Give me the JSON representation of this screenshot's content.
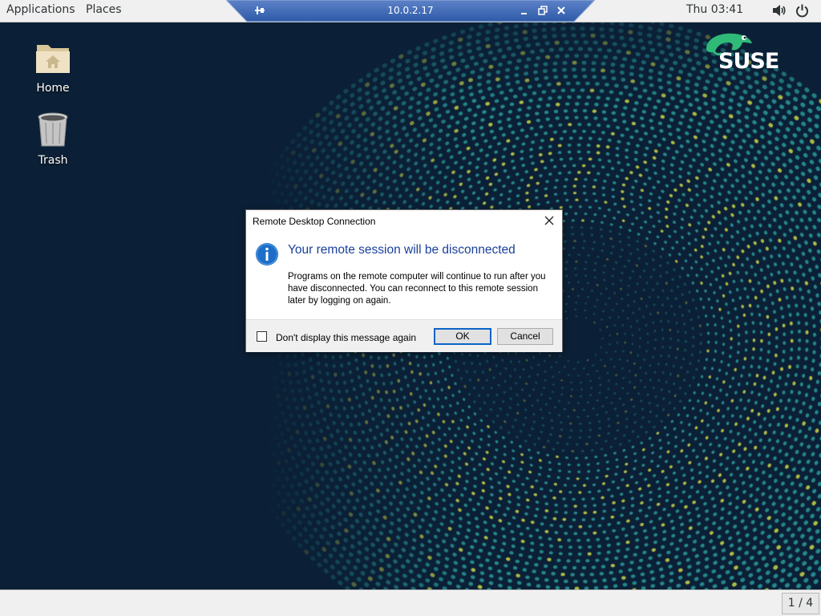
{
  "top_panel": {
    "applications_label": "Applications",
    "places_label": "Places",
    "clock": "Thu 03:41"
  },
  "rdp_bar": {
    "title": "10.0.2.17"
  },
  "desktop": {
    "icons": [
      {
        "label": "Home",
        "icon": "home-folder-icon"
      },
      {
        "label": "Trash",
        "icon": "trash-icon"
      }
    ],
    "logo": "SUSE"
  },
  "dialog": {
    "title": "Remote Desktop Connection",
    "heading": "Your remote session will be disconnected",
    "body": "Programs on the remote computer will continue to run after you have disconnected. You can reconnect to this remote session later by logging on again.",
    "checkbox_label": "Don't display this message again",
    "checkbox_checked": false,
    "ok_label": "OK",
    "cancel_label": "Cancel"
  },
  "bottom_panel": {
    "workspace": "1 / 4"
  },
  "colors": {
    "desktop_bg": "#0b2036",
    "dot_teal": "#2a9a9a",
    "dot_yellow": "#c8d84a",
    "dialog_heading": "#1a3f9c",
    "suse_green": "#30ba78"
  }
}
